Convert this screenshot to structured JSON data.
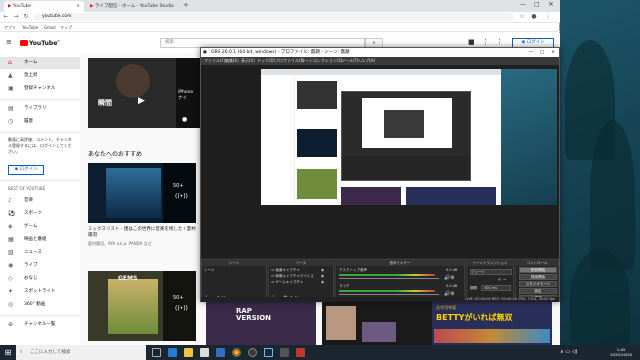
{
  "browser": {
    "tabs": [
      "YouTube",
      "ライブ配信 - ホーム - YouTube Studio"
    ],
    "address": "youtube.com",
    "bookmarks": [
      "アプリ",
      "YouTube",
      "Gmail",
      "マップ"
    ]
  },
  "youtube": {
    "logo": "YouTube",
    "logo_suffix": "JP",
    "search_placeholder": "検索",
    "login_label": "ログイン",
    "sidebar": {
      "items": [
        {
          "label": "ホーム",
          "icon": "home-icon"
        },
        {
          "label": "急上昇",
          "icon": "trending-icon"
        },
        {
          "label": "登録チャンネル",
          "icon": "subscriptions-icon"
        },
        {
          "label": "ライブラリ",
          "icon": "library-icon"
        },
        {
          "label": "履歴",
          "icon": "history-icon"
        }
      ],
      "login_prompt": "動画に高評価、コメント、チャンネル登録するには、ログインしてください。",
      "login_button": "ログイン",
      "best_heading": "BEST OF YOUTUBE",
      "best_items": [
        {
          "label": "音楽",
          "icon": "music-icon"
        },
        {
          "label": "スポーツ",
          "icon": "sports-icon"
        },
        {
          "label": "ゲーム",
          "icon": "game-icon"
        },
        {
          "label": "映画と番組",
          "icon": "movie-icon"
        },
        {
          "label": "ニュース",
          "icon": "news-icon"
        },
        {
          "label": "ライブ",
          "icon": "live-icon"
        },
        {
          "label": "おなじ",
          "icon": "fashion-icon"
        },
        {
          "label": "スポットライト",
          "icon": "spotlight-icon"
        },
        {
          "label": "360° 動画",
          "icon": "360-icon"
        }
      ],
      "more_label": "チャンネル一覧"
    },
    "main": {
      "top_thumb_text": "瞬間",
      "top_thumb2_text": "iPhone\nナイ",
      "section_title": "あなたへのおすすめ",
      "video_title": "ミックスリスト - 僕はこの世界に音楽を残した / 夏村陽羽",
      "video_meta": "夏村陽羽、AYA a.k.a. PANDA など",
      "mix_count": "50+",
      "thumb_bottom_text": "GEMS",
      "thumb_bottom2_text": "RAP\nVERSION",
      "thumb_bottom3_text": "BETTYがいれば無双",
      "thumb_bottom3_sub": "天才司令塔"
    }
  },
  "obs": {
    "title": "OBS 26.0.1 (64 bit, windows) - プロファイル: 無題 - シーン: 無題",
    "menu": [
      "ファイル(F)",
      "編集(E)",
      "表示(V)",
      "ドック(D)",
      "プロファイル(P)",
      "シーンコレクション(S)",
      "ツール(T)",
      "ヘルプ(H)"
    ],
    "docks": {
      "scenes": {
        "title": "シーン",
        "items": [
          "シーン"
        ]
      },
      "sources": {
        "title": "ソース",
        "items": [
          "画面キャプチャ",
          "映像キャプチャデバイス",
          "ゲームキャプチャ"
        ]
      },
      "mixer": {
        "title": "音声ミキサー",
        "items": [
          {
            "name": "デスクトップ音声",
            "db": "0.0 dB"
          },
          {
            "name": "マイク",
            "db": "0.0 dB"
          }
        ]
      },
      "transitions": {
        "title": "シーントランジション",
        "type": "フェード",
        "duration_label": "期間",
        "duration": "300 ms"
      },
      "controls": {
        "title": "コントロール",
        "buttons": [
          "配信開始",
          "録画開始",
          "スタジオモード",
          "設定",
          "終了"
        ]
      }
    },
    "status": "LIVE: 00:00:00    REC: 00:00:00    CPU: 3.5%, 30.00 fps"
  },
  "taskbar": {
    "search_placeholder": "ここに入力して検索",
    "time": "1:45",
    "date": "2020/10/30"
  }
}
